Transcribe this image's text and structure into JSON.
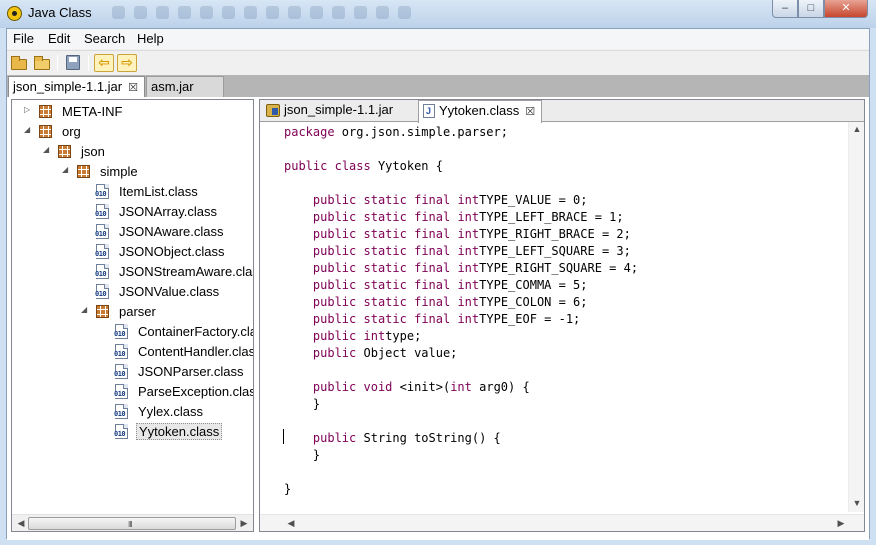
{
  "window": {
    "title": "Java Class",
    "minimize_glyph": "–",
    "maximize_glyph": "□",
    "close_glyph": "✕"
  },
  "menu": [
    "File",
    "Edit",
    "Search",
    "Help"
  ],
  "toolbar": {
    "buttons": [
      "open-folder-icon",
      "open-recent-folder-icon",
      "save-icon",
      "back-arrow-icon",
      "forward-arrow-icon"
    ],
    "back_glyph": "⇦",
    "forward_glyph": "⇨"
  },
  "file_tabs": [
    {
      "label": "json_simple-1.1.jar",
      "active": true,
      "close_glyph": "☒"
    },
    {
      "label": "asm.jar",
      "active": false
    }
  ],
  "tree": [
    {
      "label": "META-INF",
      "depth": 0,
      "expander": "▷",
      "icon": "package"
    },
    {
      "label": "org",
      "depth": 0,
      "expander": "◢",
      "icon": "package"
    },
    {
      "label": "json",
      "depth": 1,
      "expander": "◢",
      "icon": "package"
    },
    {
      "label": "simple",
      "depth": 2,
      "expander": "◢",
      "icon": "package"
    },
    {
      "label": "ItemList.class",
      "depth": 3,
      "expander": "",
      "icon": "class"
    },
    {
      "label": "JSONArray.class",
      "depth": 3,
      "expander": "",
      "icon": "class"
    },
    {
      "label": "JSONAware.class",
      "depth": 3,
      "expander": "",
      "icon": "class"
    },
    {
      "label": "JSONObject.class",
      "depth": 3,
      "expander": "",
      "icon": "class"
    },
    {
      "label": "JSONStreamAware.class",
      "depth": 3,
      "expander": "",
      "icon": "class"
    },
    {
      "label": "JSONValue.class",
      "depth": 3,
      "expander": "",
      "icon": "class"
    },
    {
      "label": "parser",
      "depth": 3,
      "expander": "◢",
      "icon": "package"
    },
    {
      "label": "ContainerFactory.class",
      "depth": 4,
      "expander": "",
      "icon": "class"
    },
    {
      "label": "ContentHandler.class",
      "depth": 4,
      "expander": "",
      "icon": "class"
    },
    {
      "label": "JSONParser.class",
      "depth": 4,
      "expander": "",
      "icon": "class"
    },
    {
      "label": "ParseException.class",
      "depth": 4,
      "expander": "",
      "icon": "class"
    },
    {
      "label": "Yylex.class",
      "depth": 4,
      "expander": "",
      "icon": "class"
    },
    {
      "label": "Yytoken.class",
      "depth": 4,
      "expander": "",
      "icon": "class",
      "selected": true
    }
  ],
  "class_icon_text": "010",
  "scroll": {
    "left": "◀",
    "right": "▶",
    "up": "▲",
    "down": "▼",
    "grip": "III"
  },
  "editor": {
    "tabs": [
      {
        "label": "json_simple-1.1.jar",
        "icon": "jar",
        "active": false
      },
      {
        "label": "Yytoken.class",
        "icon": "class",
        "active": true,
        "close_glyph": "☒"
      }
    ],
    "code": [
      [
        {
          "t": "package",
          "kw": true
        },
        {
          "t": " org.json.simple.parser;"
        }
      ],
      [],
      [
        {
          "t": "public",
          "kw": true
        },
        {
          "t": " "
        },
        {
          "t": "class",
          "kw": true
        },
        {
          "t": " Yytoken {"
        }
      ],
      [],
      [
        {
          "t": "    "
        },
        {
          "t": "public",
          "kw": true
        },
        {
          "t": " "
        },
        {
          "t": "static",
          "kw": true
        },
        {
          "t": " "
        },
        {
          "t": "final",
          "kw": true
        },
        {
          "t": " "
        },
        {
          "t": "int",
          "kw": true
        },
        {
          "t": "TYPE_VALUE = 0;"
        }
      ],
      [
        {
          "t": "    "
        },
        {
          "t": "public",
          "kw": true
        },
        {
          "t": " "
        },
        {
          "t": "static",
          "kw": true
        },
        {
          "t": " "
        },
        {
          "t": "final",
          "kw": true
        },
        {
          "t": " "
        },
        {
          "t": "int",
          "kw": true
        },
        {
          "t": "TYPE_LEFT_BRACE = 1;"
        }
      ],
      [
        {
          "t": "    "
        },
        {
          "t": "public",
          "kw": true
        },
        {
          "t": " "
        },
        {
          "t": "static",
          "kw": true
        },
        {
          "t": " "
        },
        {
          "t": "final",
          "kw": true
        },
        {
          "t": " "
        },
        {
          "t": "int",
          "kw": true
        },
        {
          "t": "TYPE_RIGHT_BRACE = 2;"
        }
      ],
      [
        {
          "t": "    "
        },
        {
          "t": "public",
          "kw": true
        },
        {
          "t": " "
        },
        {
          "t": "static",
          "kw": true
        },
        {
          "t": " "
        },
        {
          "t": "final",
          "kw": true
        },
        {
          "t": " "
        },
        {
          "t": "int",
          "kw": true
        },
        {
          "t": "TYPE_LEFT_SQUARE = 3;"
        }
      ],
      [
        {
          "t": "    "
        },
        {
          "t": "public",
          "kw": true
        },
        {
          "t": " "
        },
        {
          "t": "static",
          "kw": true
        },
        {
          "t": " "
        },
        {
          "t": "final",
          "kw": true
        },
        {
          "t": " "
        },
        {
          "t": "int",
          "kw": true
        },
        {
          "t": "TYPE_RIGHT_SQUARE = 4;"
        }
      ],
      [
        {
          "t": "    "
        },
        {
          "t": "public",
          "kw": true
        },
        {
          "t": " "
        },
        {
          "t": "static",
          "kw": true
        },
        {
          "t": " "
        },
        {
          "t": "final",
          "kw": true
        },
        {
          "t": " "
        },
        {
          "t": "int",
          "kw": true
        },
        {
          "t": "TYPE_COMMA = 5;"
        }
      ],
      [
        {
          "t": "    "
        },
        {
          "t": "public",
          "kw": true
        },
        {
          "t": " "
        },
        {
          "t": "static",
          "kw": true
        },
        {
          "t": " "
        },
        {
          "t": "final",
          "kw": true
        },
        {
          "t": " "
        },
        {
          "t": "int",
          "kw": true
        },
        {
          "t": "TYPE_COLON = 6;"
        }
      ],
      [
        {
          "t": "    "
        },
        {
          "t": "public",
          "kw": true
        },
        {
          "t": " "
        },
        {
          "t": "static",
          "kw": true
        },
        {
          "t": " "
        },
        {
          "t": "final",
          "kw": true
        },
        {
          "t": " "
        },
        {
          "t": "int",
          "kw": true
        },
        {
          "t": "TYPE_EOF = -1;"
        }
      ],
      [
        {
          "t": "    "
        },
        {
          "t": "public",
          "kw": true
        },
        {
          "t": " "
        },
        {
          "t": "int",
          "kw": true
        },
        {
          "t": "type;"
        }
      ],
      [
        {
          "t": "    "
        },
        {
          "t": "public",
          "kw": true
        },
        {
          "t": " Object value;"
        }
      ],
      [],
      [
        {
          "t": "    "
        },
        {
          "t": "public",
          "kw": true
        },
        {
          "t": " "
        },
        {
          "t": "void",
          "kw": true
        },
        {
          "t": " <init>("
        },
        {
          "t": "int",
          "kw": true
        },
        {
          "t": " arg0) {"
        }
      ],
      [
        {
          "t": "    }"
        }
      ],
      [],
      [
        {
          "t": "    "
        },
        {
          "t": "public",
          "kw": true
        },
        {
          "t": " String toString() {"
        }
      ],
      [
        {
          "t": "    }"
        }
      ],
      [],
      [
        {
          "t": "}"
        }
      ]
    ]
  },
  "colors": {
    "keyword": "#7f0055",
    "title_bar": "#cfe0f2",
    "close_button": "#c6462c"
  }
}
